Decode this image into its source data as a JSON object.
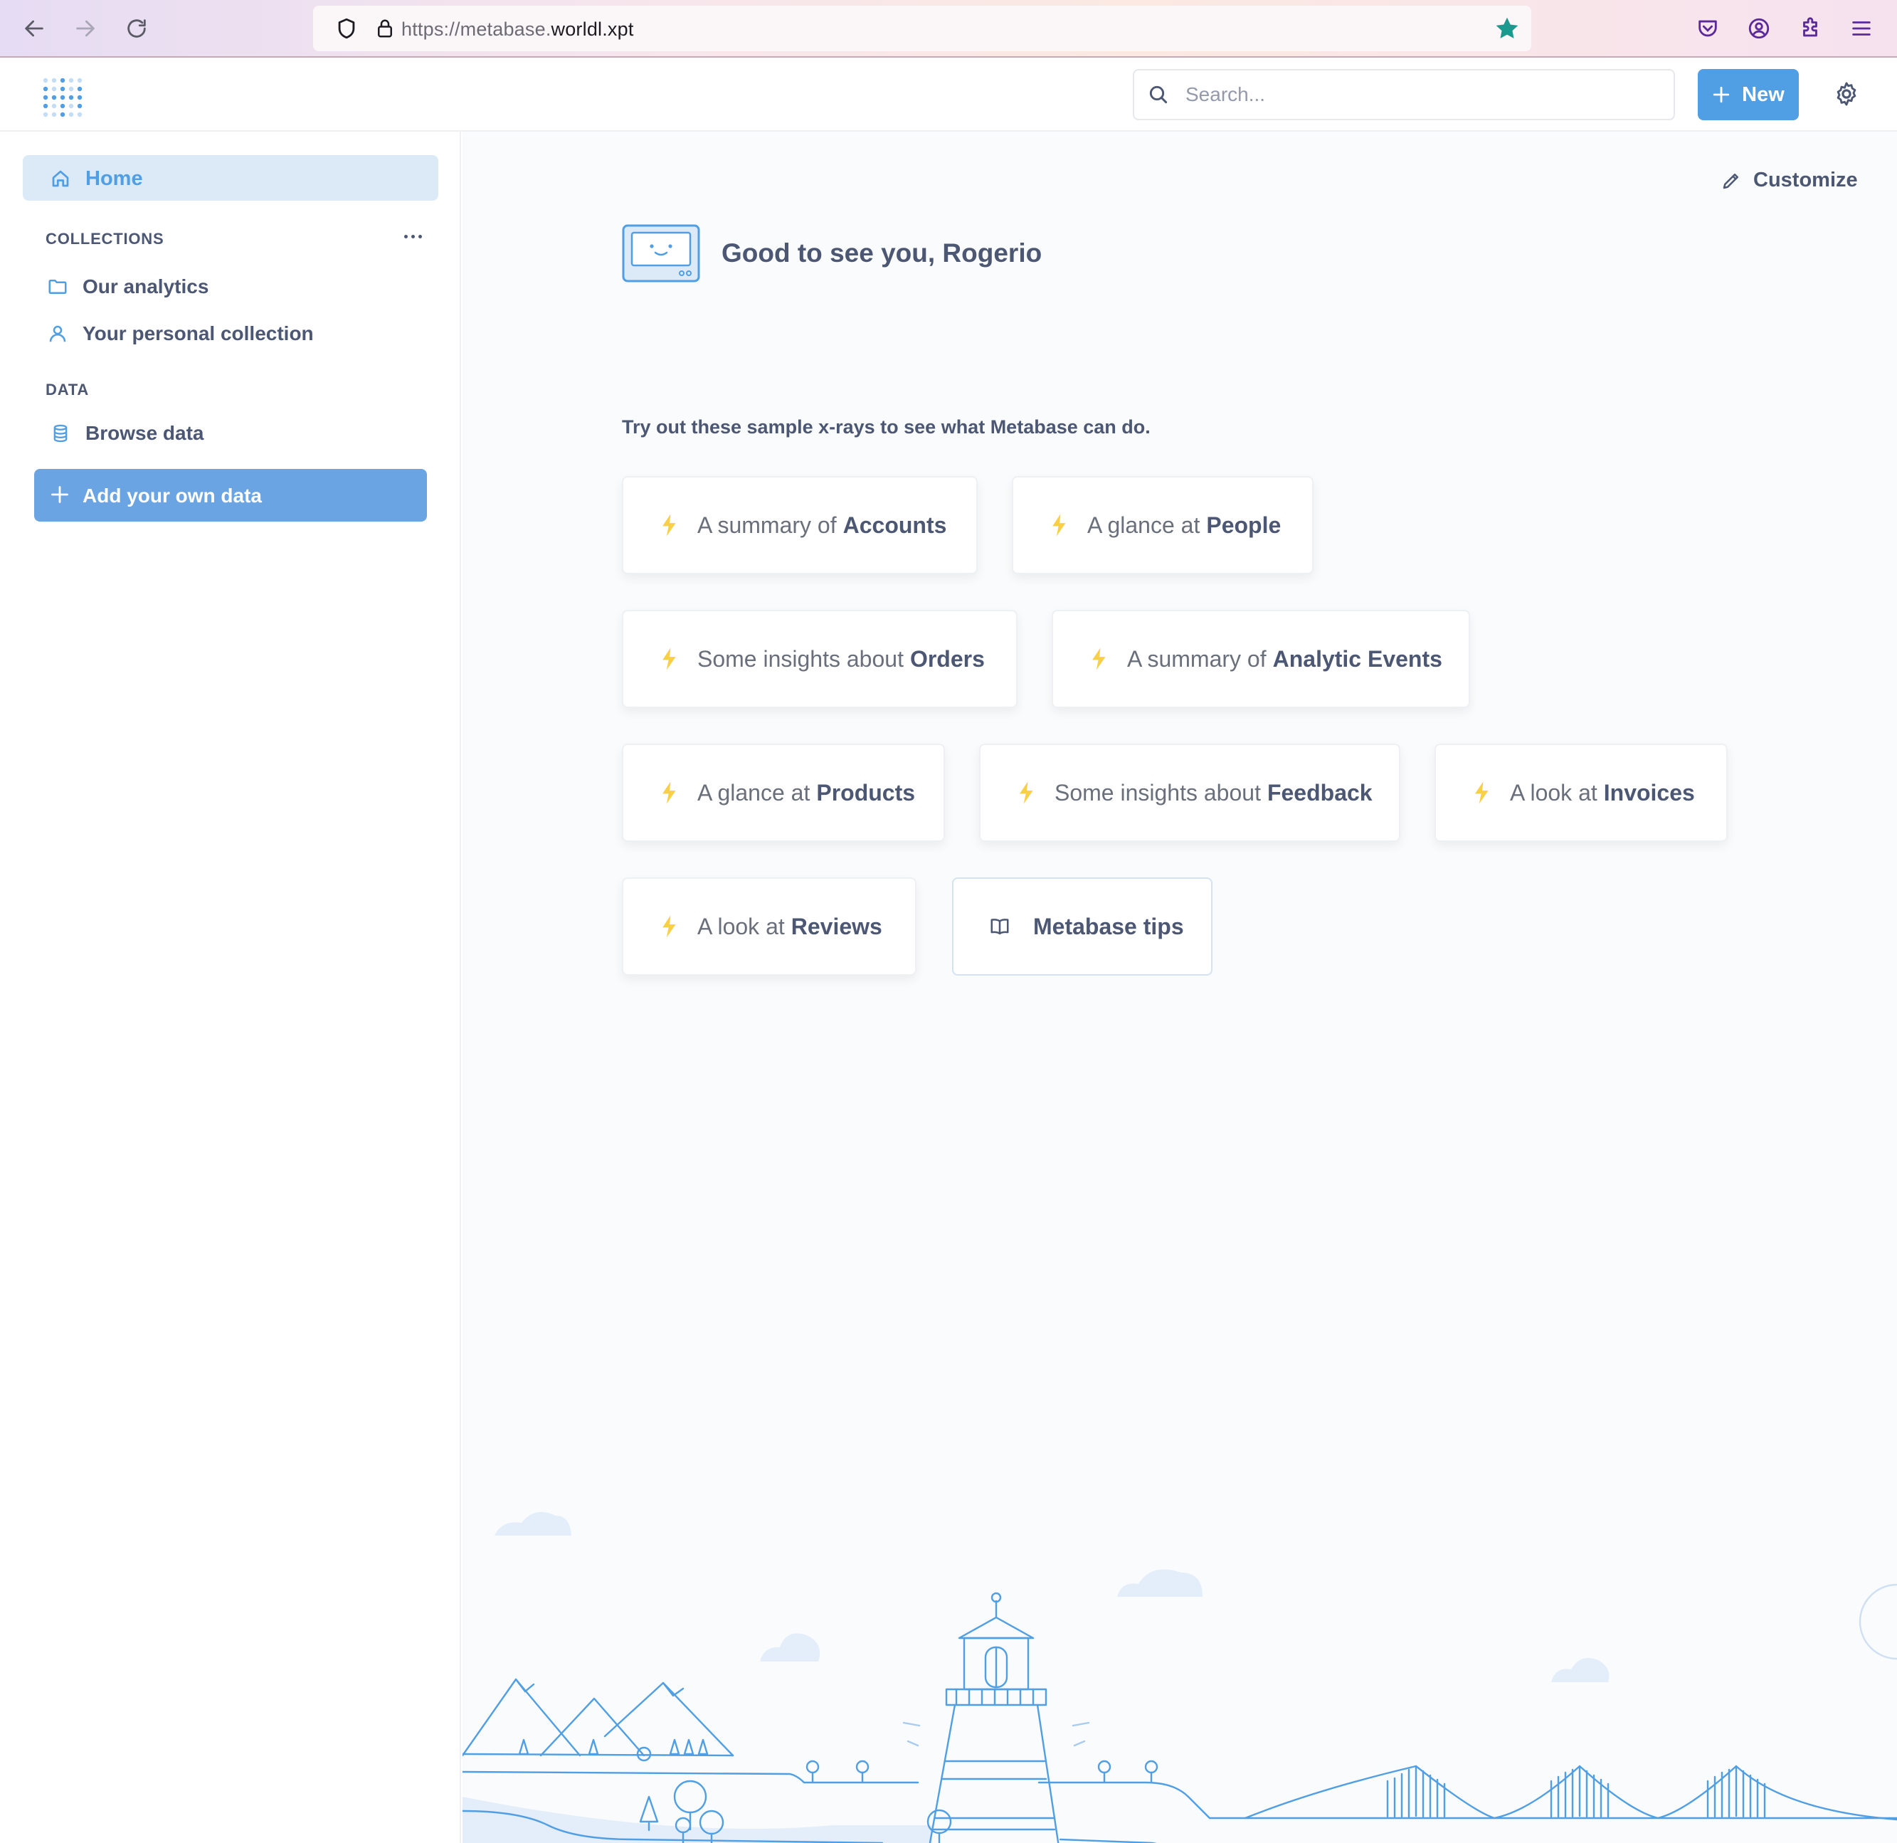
{
  "browser": {
    "url_prefix": "https://metabase.",
    "url_domain": "worldl.xpt"
  },
  "header": {
    "search_placeholder": "Search...",
    "new_label": "New"
  },
  "sidebar": {
    "home_label": "Home",
    "collections_title": "COLLECTIONS",
    "collections": [
      {
        "label": "Our analytics",
        "icon": "folder-icon"
      },
      {
        "label": "Your personal collection",
        "icon": "person-icon"
      }
    ],
    "data_title": "DATA",
    "browse_label": "Browse data",
    "add_data_label": "Add your own data"
  },
  "main": {
    "customize_label": "Customize",
    "greeting": "Good to see you, Rogerio",
    "intro": "Try out these sample x-rays to see what Metabase can do.",
    "xrays": [
      {
        "prefix": "A summary of",
        "name": "Accounts"
      },
      {
        "prefix": "A glance at",
        "name": "People"
      },
      {
        "prefix": "Some insights about",
        "name": "Orders"
      },
      {
        "prefix": "A summary of",
        "name": "Analytic Events"
      },
      {
        "prefix": "A glance at",
        "name": "Products"
      },
      {
        "prefix": "Some insights about",
        "name": "Feedback"
      },
      {
        "prefix": "A look at",
        "name": "Invoices"
      },
      {
        "prefix": "A look at",
        "name": "Reviews"
      }
    ],
    "tips_label": "Metabase tips"
  },
  "colors": {
    "brand": "#509ee3",
    "text": "#4c5773",
    "bolt": "#f9cf48"
  }
}
